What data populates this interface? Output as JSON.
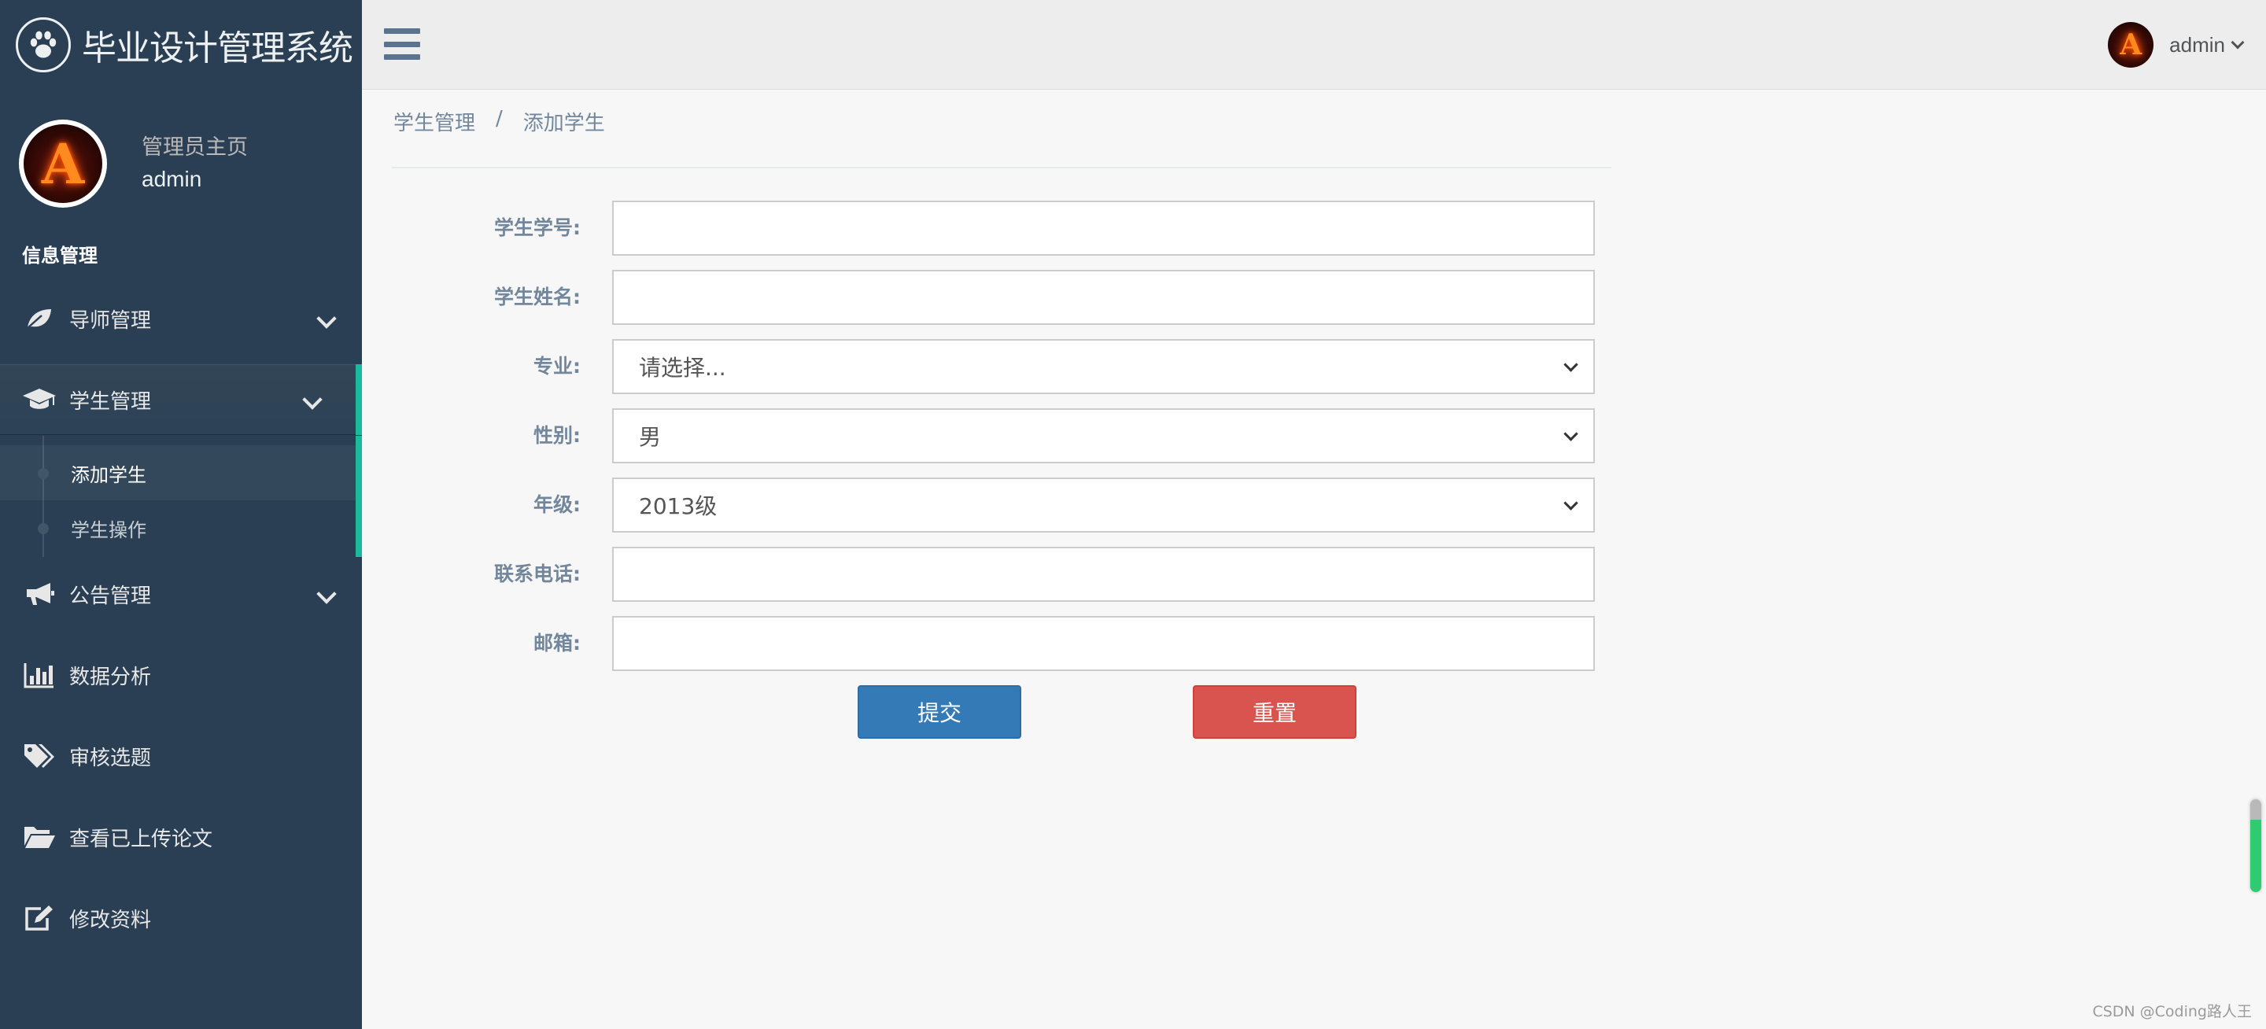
{
  "brand": {
    "title": "毕业设计管理系统",
    "logo_icon": "paw-icon"
  },
  "profile": {
    "welcome": "管理员主页",
    "name": "admin",
    "avatar_glyph": "A"
  },
  "sidebar": {
    "section_title": "信息管理",
    "items": [
      {
        "label": "导师管理",
        "icon": "leaf-icon",
        "has_chevron": true
      },
      {
        "label": "学生管理",
        "icon": "graduation-cap-icon",
        "has_chevron": true,
        "active": true
      },
      {
        "label": "公告管理",
        "icon": "bullhorn-icon",
        "has_chevron": true
      },
      {
        "label": "数据分析",
        "icon": "bar-chart-icon"
      },
      {
        "label": "审核选题",
        "icon": "tags-icon"
      },
      {
        "label": "查看已上传论文",
        "icon": "folder-open-icon"
      },
      {
        "label": "修改资料",
        "icon": "edit-icon"
      }
    ],
    "submenu": [
      {
        "label": "添加学生",
        "current": true
      },
      {
        "label": "学生操作"
      }
    ]
  },
  "topnav": {
    "user_name": "admin",
    "avatar_glyph": "A",
    "menu_icon": "hamburger-icon"
  },
  "breadcrumb": {
    "items": [
      "学生管理",
      "添加学生"
    ],
    "separator": "/"
  },
  "form": {
    "student_id_label": "学生学号:",
    "student_id_value": "",
    "student_name_label": "学生姓名:",
    "student_name_value": "",
    "major_label": "专业:",
    "major_selected": "请选择...",
    "gender_label": "性别:",
    "gender_selected": "男",
    "grade_label": "年级:",
    "grade_selected": "2013级",
    "phone_label": "联系电话:",
    "phone_value": "",
    "email_label": "邮箱:",
    "email_value": ""
  },
  "buttons": {
    "submit_label": "提交",
    "reset_label": "重置"
  },
  "colors": {
    "sidebar_bg": "#2a3f54",
    "active_accent": "#1abb9c",
    "primary": "#337ab7",
    "danger": "#d9534f"
  },
  "watermark": "CSDN @Coding路人王"
}
